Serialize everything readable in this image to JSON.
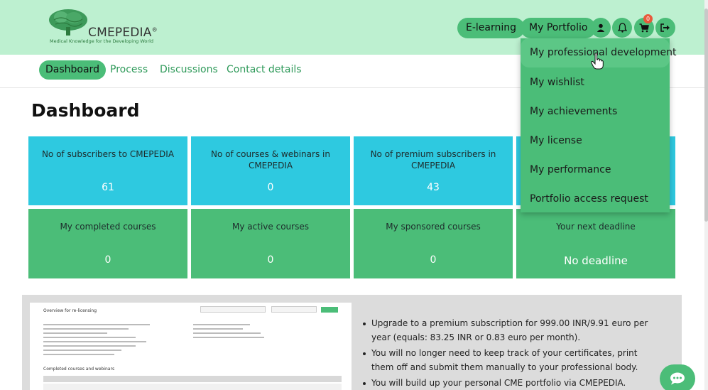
{
  "brand": {
    "name": "CMEPEDIA",
    "reg": "®",
    "tagline": "Medical Knowledge for the Developing World"
  },
  "header": {
    "elearning": "E-learning",
    "portfolio": "My Portfolio",
    "cart_count": "0",
    "icons": [
      "user-icon",
      "bell-icon",
      "cart-icon",
      "logout-icon"
    ]
  },
  "nav": {
    "items": [
      "Dashboard",
      "Process",
      "Discussions",
      "Contact details"
    ],
    "active": "Dashboard"
  },
  "page": {
    "title": "Dashboard"
  },
  "tiles_top": [
    {
      "label": "No of subscribers to CMEPEDIA",
      "value": "61"
    },
    {
      "label": "No of courses & webinars in CMEPEDIA",
      "value": "0"
    },
    {
      "label": "No of premium subscribers in CMEPEDIA",
      "value": "43"
    }
  ],
  "tiles_bottom": [
    {
      "label": "My completed courses",
      "value": "0"
    },
    {
      "label": "My active courses",
      "value": "0"
    },
    {
      "label": "My sponsored courses",
      "value": "0"
    },
    {
      "label": "Your next deadline",
      "value": "No deadline"
    }
  ],
  "dropdown": {
    "items": [
      "My professional development",
      "My wishlist",
      "My achievements",
      "My license",
      "My performance",
      "Portfolio access request"
    ],
    "highlighted": "My professional development"
  },
  "promo": {
    "thumb_title": "Overview for re-licensing",
    "thumb_subtitle": "Completed courses and webinars",
    "bullets": [
      "Upgrade to a premium subscription for 999.00 INR/9.91 euro per year (equals: 83.25 INR or 0.83 euro per month).",
      "You will no longer need to keep track of your certificates, print them off and submit them manually to your professional body.",
      "You will build up your personal CME portfolio via CMEPEDIA."
    ]
  },
  "colors": {
    "header_bg": "#bdf0d0",
    "accent_green": "#4bbd78",
    "tile_blue": "#2ec9e0",
    "badge_red": "#e8593b"
  }
}
